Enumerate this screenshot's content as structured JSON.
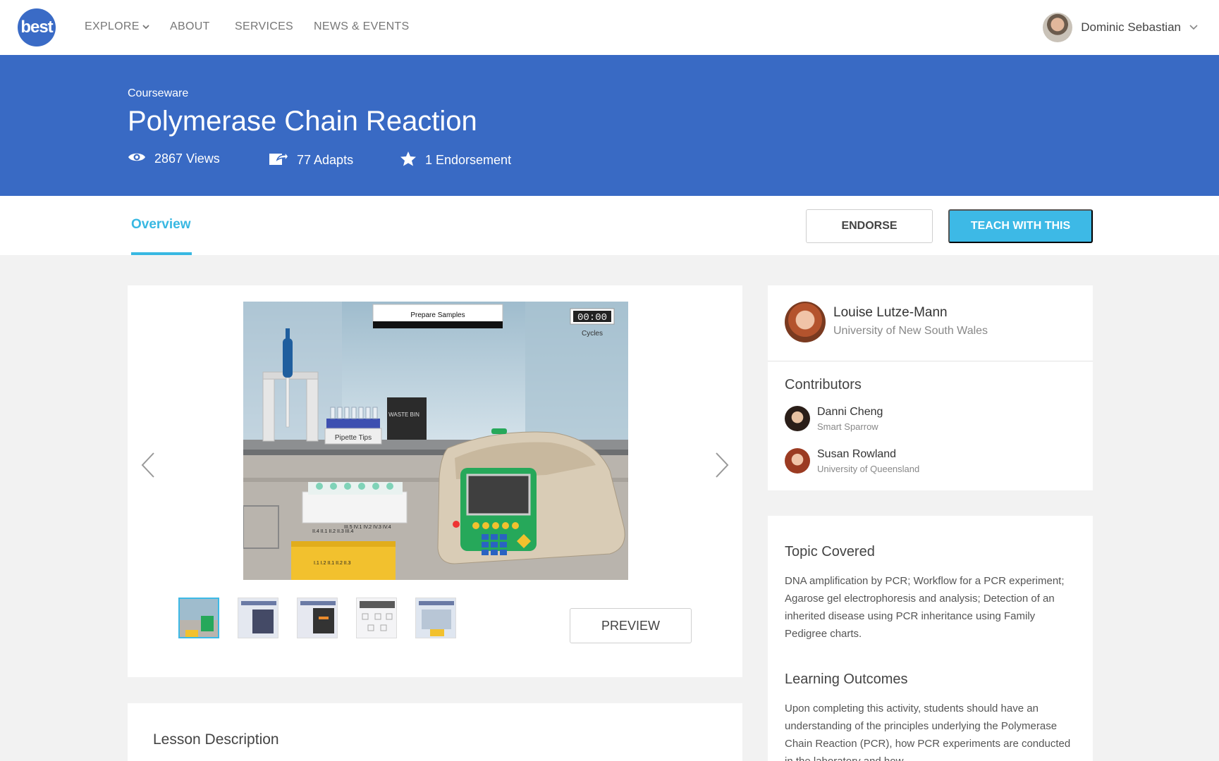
{
  "nav": {
    "logo_text": "best",
    "links": [
      "EXPLORE",
      "ABOUT",
      "SERVICES",
      "NEWS & EVENTS"
    ],
    "user_name": "Dominic Sebastian"
  },
  "hero": {
    "kicker": "Courseware",
    "title": "Polymerase Chain Reaction",
    "views": "2867 Views",
    "adapts": "77 Adapts",
    "endorsements": "1 Endorsement"
  },
  "tabs": {
    "overview": "Overview",
    "endorse": "ENDORSE",
    "teach": "TEACH WITH THIS"
  },
  "gallery": {
    "sim_banner": "Prepare Samples",
    "sim_timer": "00:00",
    "sim_timer_label": "Cycles",
    "sim_waste_bin": "WASTE BIN",
    "sim_pipette_tips": "Pipette Tips",
    "sim_labels_top": "II.4  II.1  II.2  II.3  III.4",
    "sim_labels_mid": "III.5  IV.1 IV.2 IV.3 IV.4",
    "sim_labels_bottom": "I.1  I.2  II.1  II.2  II.3",
    "preview": "PREVIEW"
  },
  "lesson": {
    "title": "Lesson Description"
  },
  "author": {
    "name": "Louise Lutze-Mann",
    "institution": "University of New South Wales",
    "contributors_title": "Contributors",
    "contributors": [
      {
        "name": "Danni Cheng",
        "institution": "Smart Sparrow"
      },
      {
        "name": "Susan Rowland",
        "institution": "University of Queensland"
      }
    ]
  },
  "topics": {
    "topic_title": "Topic Covered",
    "topic_text": "DNA amplification by PCR; Workflow for a PCR experiment; Agarose gel electrophoresis and analysis; Detection of an inherited disease using PCR inheritance using Family Pedigree charts.",
    "outcomes_title": "Learning Outcomes",
    "outcomes_text": "Upon completing this activity, students should have an understanding of the principles underlying the Polymerase Chain Reaction (PCR), how PCR experiments are conducted in the laboratory and how"
  },
  "colors": {
    "hero_blue": "#396ac4",
    "accent_cyan": "#3db9e6"
  }
}
